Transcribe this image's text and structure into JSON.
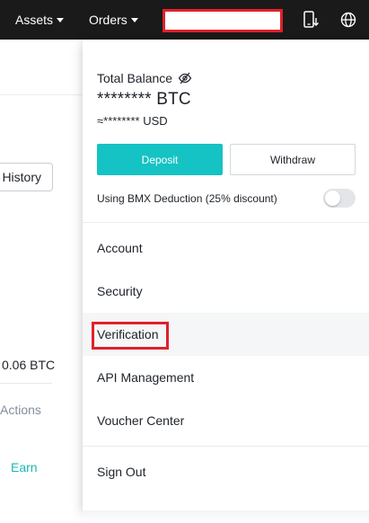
{
  "topbar": {
    "nav_items": [
      {
        "label": "Assets",
        "icon": "caret-down-icon"
      },
      {
        "label": "Orders",
        "icon": "caret-down-icon"
      }
    ],
    "icons": [
      "phone-download-icon",
      "globe-icon"
    ],
    "colors": {
      "background": "#1a1a1a",
      "text": "#ffffff",
      "highlight": "#e0202a"
    }
  },
  "background_page": {
    "history_button": "History",
    "amount": "0.06 BTC",
    "actions_label": "Actions",
    "earn_link": "Earn"
  },
  "dropdown": {
    "total_balance_label": "Total Balance",
    "hide_balance_icon": "eye-slash-icon",
    "balance_btc": "******** BTC",
    "balance_usd": "≈******** USD",
    "deposit_label": "Deposit",
    "withdraw_label": "Withdraw",
    "deduction_label": "Using BMX Deduction (25% discount)",
    "deduction_enabled": false,
    "menu_items": [
      {
        "label": "Account"
      },
      {
        "label": "Security"
      },
      {
        "label": "Verification",
        "highlighted": true
      },
      {
        "label": "API Management"
      },
      {
        "label": "Voucher Center"
      },
      {
        "label": "Sign Out"
      }
    ],
    "colors": {
      "accent": "#15c2c4",
      "earn_link": "#16b8b3"
    }
  }
}
